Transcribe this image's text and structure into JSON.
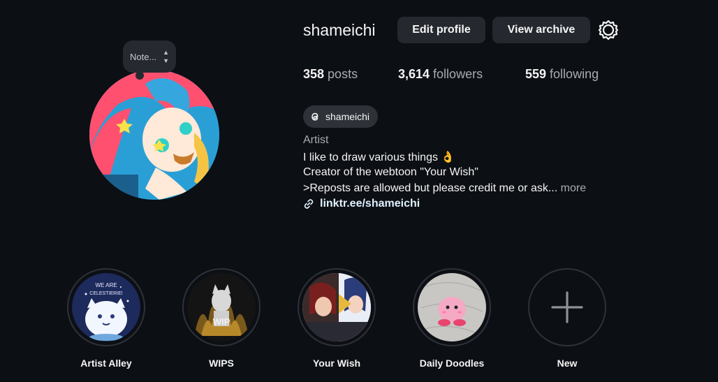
{
  "profile": {
    "username": "shameichi",
    "note_placeholder": "Note...",
    "avatar_icon": "profile-avatar-art"
  },
  "actions": {
    "edit_profile": "Edit profile",
    "view_archive": "View archive",
    "settings_icon": "gear-icon"
  },
  "stats": {
    "posts_count": "358",
    "posts_label": " posts",
    "followers_count": "3,614",
    "followers_label": " followers",
    "following_count": "559",
    "following_label": " following"
  },
  "threads": {
    "icon": "threads-icon",
    "handle": "shameichi"
  },
  "bio": {
    "category": "Artist",
    "line1": "I like to draw various things 👌",
    "line2": "Creator of the webtoon \"Your Wish\"",
    "line3": ">Reposts are allowed but please credit me or ask...",
    "more": " more",
    "link_icon": "link-icon",
    "link": "linktr.ee/shameichi"
  },
  "highlights": [
    {
      "label": "Artist Alley",
      "cover_text": "WE ARE CELESTIERIE!"
    },
    {
      "label": "WIPS",
      "cover_text": "WIP"
    },
    {
      "label": "Your Wish"
    },
    {
      "label": "Daily Doodles"
    },
    {
      "label": "New",
      "icon": "plus-icon"
    }
  ],
  "colors": {
    "background": "#0c0f14",
    "button": "#25292f",
    "secondary_text": "#a8abb0",
    "link_text": "#e0f1ff"
  }
}
